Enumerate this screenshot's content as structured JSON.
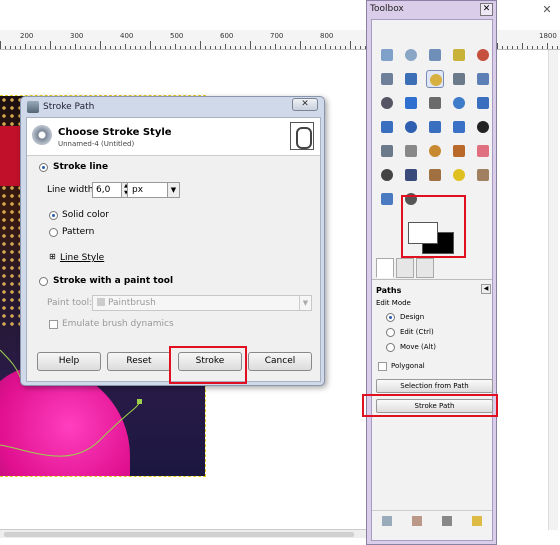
{
  "canvas": {
    "ruler_labels": [
      "200",
      "300",
      "400",
      "500",
      "600",
      "700",
      "800"
    ],
    "ruler_right_labels": [
      "1800"
    ]
  },
  "dialog": {
    "title": "Stroke Path",
    "close_label": "✕",
    "heading": "Choose Stroke Style",
    "subheading": "Unnamed-4 (Untitled)",
    "stroke_line_label": "Stroke line",
    "line_width_label": "Line width:",
    "line_width_value": "6,0",
    "unit_value": "px",
    "solid_color_label": "Solid color",
    "pattern_label": "Pattern",
    "line_style_label": "Line Style",
    "paint_tool_option_label": "Stroke with a paint tool",
    "paint_tool_label": "Paint tool:",
    "paint_tool_value": "Paintbrush",
    "emulate_label": "Emulate brush dynamics",
    "buttons": {
      "help": "Help",
      "reset": "Reset",
      "stroke": "Stroke",
      "cancel": "Cancel"
    }
  },
  "toolbox": {
    "title": "Toolbox",
    "close_label": "✕",
    "tools": [
      "rect-select-icon",
      "ellipse-select-icon",
      "lasso-icon",
      "magic-wand-icon",
      "color-select-icon",
      "scissors-icon",
      "foreground-select-icon",
      "paths-icon",
      "color-picker-icon",
      "zoom-icon",
      "measure-icon",
      "move-icon",
      "align-icon",
      "crop-icon",
      "rotate-icon",
      "scale-icon",
      "shear-icon",
      "perspective-icon",
      "flip-icon",
      "text-icon",
      "bucket-fill-icon",
      "blend-icon",
      "pencil-icon",
      "paintbrush-icon",
      "eraser-icon",
      "airbrush-icon",
      "ink-icon",
      "clone-icon",
      "heal-icon",
      "perspective-clone-icon",
      "smudge-icon",
      "dodge-burn-icon"
    ],
    "paths_panel": {
      "title": "Paths",
      "edit_mode_label": "Edit Mode",
      "modes": [
        "Design",
        "Edit (Ctrl)",
        "Move (Alt)"
      ],
      "polygonal_label": "Polygonal",
      "selection_from_path": "Selection from Path",
      "stroke_path": "Stroke Path"
    }
  },
  "colors": {
    "highlight": "#e01020",
    "toolbox_bg": "#d9cde9",
    "dialog_frame": "#cfd9ea"
  }
}
